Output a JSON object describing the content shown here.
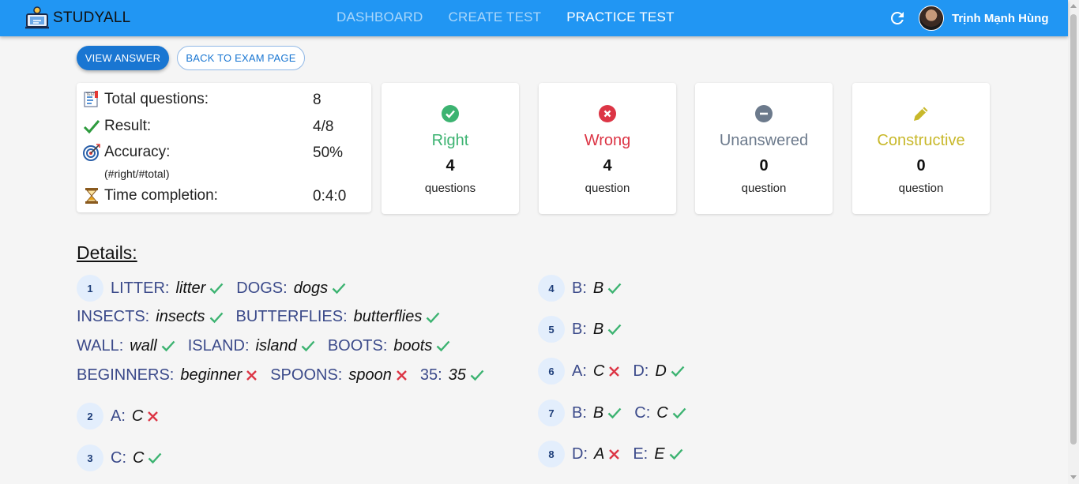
{
  "header": {
    "logo_text": "STUDYALL",
    "tabs": [
      {
        "label": "DASHBOARD",
        "active": false
      },
      {
        "label": "CREATE TEST",
        "active": false
      },
      {
        "label": "PRACTICE TEST",
        "active": true
      }
    ],
    "user_name": "Trịnh Mạnh Hùng"
  },
  "actions": {
    "view_answer": "VIEW ANSWER",
    "back_to_exam": "BACK TO EXAM PAGE"
  },
  "summary": {
    "total_label": "Total questions:",
    "total_value": "8",
    "result_label": "Result:",
    "result_value": "4/8",
    "accuracy_label": "Accuracy:",
    "accuracy_value": "50%",
    "accuracy_note": "(#right/#total)",
    "time_label": "Time completion:",
    "time_value": "0:4:0"
  },
  "stats": [
    {
      "title": "Right",
      "count": "4",
      "unit": "questions",
      "color": "#3cb371",
      "icon": "check-circle-icon"
    },
    {
      "title": "Wrong",
      "count": "4",
      "unit": "question",
      "color": "#dc3545",
      "icon": "x-circle-icon"
    },
    {
      "title": "Unanswered",
      "count": "0",
      "unit": "question",
      "color": "#6c7a8c",
      "icon": "minus-circle-icon"
    },
    {
      "title": "Constructive",
      "count": "0",
      "unit": "question",
      "color": "#c8b82a",
      "icon": "pencil-icon"
    }
  ],
  "details": {
    "title": "Details:",
    "questions": [
      {
        "number": "1",
        "lines": [
          [
            {
              "label": "LITTER:",
              "value": "litter",
              "correct": true
            },
            {
              "label": "DOGS:",
              "value": "dogs",
              "correct": true
            }
          ],
          [
            {
              "label": "INSECTS:",
              "value": "insects",
              "correct": true
            },
            {
              "label": "BUTTERFLIES:",
              "value": "butterflies",
              "correct": true
            }
          ],
          [
            {
              "label": "WALL:",
              "value": "wall",
              "correct": true
            },
            {
              "label": "ISLAND:",
              "value": "island",
              "correct": true
            },
            {
              "label": "BOOTS:",
              "value": "boots",
              "correct": true
            }
          ],
          [
            {
              "label": "BEGINNERS:",
              "value": "beginner",
              "correct": false
            },
            {
              "label": "SPOONS:",
              "value": "spoon",
              "correct": false
            },
            {
              "label": "35:",
              "value": "35",
              "correct": true
            }
          ]
        ]
      },
      {
        "number": "2",
        "lines": [
          [
            {
              "label": "A:",
              "value": "C",
              "correct": false
            }
          ]
        ]
      },
      {
        "number": "3",
        "lines": [
          [
            {
              "label": "C:",
              "value": "C",
              "correct": true
            }
          ]
        ]
      },
      {
        "number": "4",
        "lines": [
          [
            {
              "label": "B:",
              "value": "B",
              "correct": true
            }
          ]
        ]
      },
      {
        "number": "5",
        "lines": [
          [
            {
              "label": "B:",
              "value": "B",
              "correct": true
            }
          ]
        ]
      },
      {
        "number": "6",
        "lines": [
          [
            {
              "label": "A:",
              "value": "C",
              "correct": false
            },
            {
              "label": "D:",
              "value": "D",
              "correct": true
            }
          ]
        ]
      },
      {
        "number": "7",
        "lines": [
          [
            {
              "label": "B:",
              "value": "B",
              "correct": true
            },
            {
              "label": "C:",
              "value": "C",
              "correct": true
            }
          ]
        ]
      },
      {
        "number": "8",
        "lines": [
          [
            {
              "label": "D:",
              "value": "A",
              "correct": false
            },
            {
              "label": "E:",
              "value": "E",
              "correct": true
            }
          ]
        ]
      }
    ]
  }
}
